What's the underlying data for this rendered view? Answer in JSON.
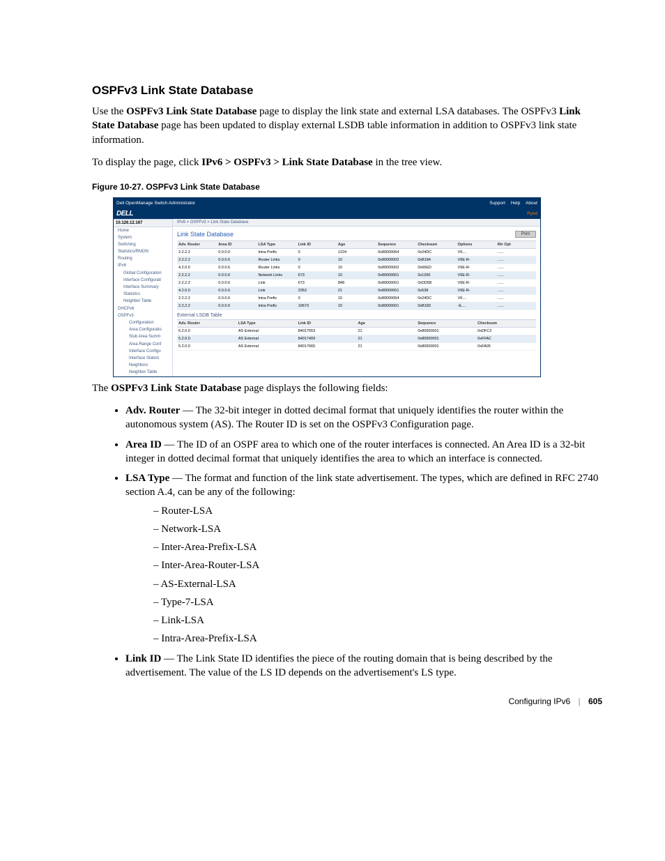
{
  "heading": "OSPFv3 Link State Database",
  "para1_a": "Use the ",
  "para1_b": "OSPFv3 Link State Database",
  "para1_c": " page to display the link state and external LSA databases. The OSPFv3 ",
  "para1_d": "Link State Database",
  "para1_e": " page has been updated to display external LSDB table information in addition to OSPFv3 link state information.",
  "para2_a": "To display the page, click ",
  "para2_b": "IPv6 > OSPFv3 > Link State Database",
  "para2_c": " in the tree view.",
  "figcap": "Figure 10-27.    OSPFv3 Link State Database",
  "def_intro": " page displays the following fields:",
  "def_intro_pre": "The ",
  "def_intro_bold": "OSPFv3 Link State Database",
  "b1_a": "Adv. Router",
  "b1_b": " — The 32-bit integer in dotted decimal format that uniquely identifies the router within the autonomous system (AS). The Router ID is set on the OSPFv3 Configuration page.",
  "b2_a": "Area ID",
  "b2_b": " — The ID of an OSPF area to which one of the router interfaces is connected. An Area ID is a 32-bit integer in dotted decimal format that uniquely identifies the area to which an interface is connected.",
  "b3_a": "LSA Type",
  "b3_b": " — The format and function of the link state advertisement. The types, which are defined in RFC 2740 section A.4, can be any of the following:",
  "d1": "Router-LSA",
  "d2": "Network-LSA",
  "d3": "Inter-Area-Prefix-LSA",
  "d4": "Inter-Area-Router-LSA",
  "d5": "AS-External-LSA",
  "d6": "Type-7-LSA",
  "d7": "Link-LSA",
  "d8": "Intra-Area-Prefix-LSA",
  "b4_a": "Link ID",
  "b4_b": " — The Link State ID identifies the piece of the routing domain that is being described by the advertisement. The value of the LS ID depends on the advertisement's LS type.",
  "footer_label": "Configuring IPv6",
  "footer_page": "605",
  "screenshot": {
    "topbar_title": "Dell OpenManage Switch Administrator",
    "topbar_support": "Support",
    "topbar_help": "Help",
    "topbar_about": "About",
    "brand": "DELL",
    "logout": "Pynd",
    "ip": "10.126.12.167",
    "breadcrumb": "IPv6 > OSPFv3 > Link State Database",
    "nav": [
      "Home",
      "System",
      "Switching",
      "Statistics/RMON",
      "Routing",
      "IPv6",
      "Global Configuration",
      "Interface Configurati",
      "Interface Summary",
      "Statistics",
      "Neighbor Table",
      "DHCPv6",
      "OSPFv3",
      "Configuration",
      "Area Configuratio",
      "Stub Area Summ",
      "Area Range Conf",
      "Interface Configu",
      "Interface Statisti",
      "Neighbors",
      "Neighbor Table"
    ],
    "navlevel": [
      1,
      1,
      1,
      1,
      1,
      1,
      2,
      2,
      2,
      2,
      2,
      1,
      1,
      3,
      3,
      3,
      3,
      3,
      3,
      3,
      3
    ],
    "page_title": "Link State Database",
    "print": "Print",
    "tbl1": {
      "headers": [
        "Adv. Router",
        "Area ID",
        "LSA Type",
        "Link ID",
        "Age",
        "Sequence",
        "Checksum",
        "Options",
        "Rtr Opt"
      ],
      "rows": [
        [
          "2.2.2.2",
          "0.0.0.0",
          "Intra Prefix",
          "0",
          "1224",
          "0x80000064",
          "0x24DC",
          "V6....",
          "......"
        ],
        [
          "2.2.2.2",
          "0.0.0.6",
          "Router Links",
          "0",
          "10",
          "0x80000002",
          "0xB184",
          "V6E-R-",
          "......"
        ],
        [
          "4.2.0.0",
          "0.0.0.6",
          "Router Links",
          "0",
          "10",
          "0x80000002",
          "0x66ED",
          "V6E-R-",
          "......"
        ],
        [
          "2.2.2.2",
          "0.0.0.6",
          "Network Links",
          "673",
          "10",
          "0x80000001",
          "0x1266",
          "V6E-R-",
          "......"
        ],
        [
          "2.2.2.2",
          "0.0.0.6",
          "Link",
          "673",
          "848",
          "0x80000001",
          "0xDD58",
          "V6E-R-",
          "......"
        ],
        [
          "4.2.0.0",
          "0.0.0.6",
          "Link",
          "2053",
          "21",
          "0x80000001",
          "0x538",
          "V6E-R-",
          "......"
        ],
        [
          "2.2.2.2",
          "0.0.0.6",
          "Intra Prefix",
          "0",
          "10",
          "0x80000064",
          "0x24DC",
          "V6....",
          "......"
        ],
        [
          "2.2.2.2",
          "0.0.0.6",
          "Intra Prefix",
          "10673",
          "10",
          "0x80000001",
          "0xB183",
          "-E....",
          "......"
        ]
      ]
    },
    "ext_title": "External LSDB Table",
    "tbl2": {
      "headers": [
        "Adv. Router",
        "LSA Type",
        "Link ID",
        "Age",
        "Sequence",
        "Checksum"
      ],
      "rows": [
        [
          "5.2.0.0",
          "AS External",
          "84017553",
          "21",
          "0x80000001",
          "0xDFC2"
        ],
        [
          "5.2.0.0",
          "AS External",
          "84017409",
          "21",
          "0x80000001",
          "0xFFAC"
        ],
        [
          "5.2.0.0",
          "AS External",
          "84017665",
          "21",
          "0x80000001",
          "0xFA05"
        ]
      ]
    }
  }
}
